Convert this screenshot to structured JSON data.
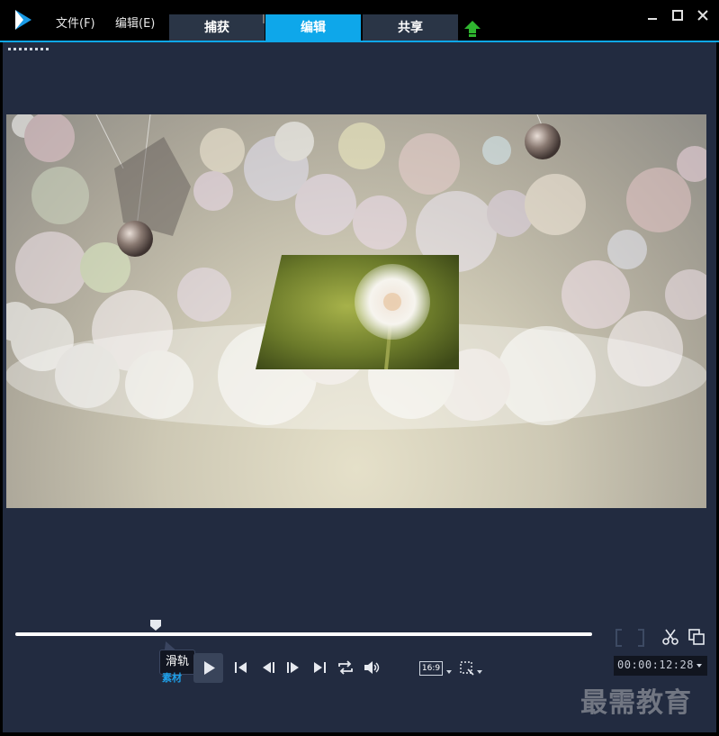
{
  "menu": {
    "file": "文件(F)",
    "edit": "编辑(E)"
  },
  "tabs": [
    {
      "label": "捕获",
      "active": false
    },
    {
      "label": "编辑",
      "active": true
    },
    {
      "label": "共享",
      "active": false
    }
  ],
  "icons": {
    "app_logo": "play-logo-icon",
    "upload": "upload-arrow-icon",
    "minimize": "minimize-icon",
    "maximize": "maximize-icon",
    "close": "close-icon",
    "scissors": "scissors-icon",
    "copy": "copy-icon",
    "crop": "crop-icon"
  },
  "colors": {
    "accent": "#0ea7ea",
    "workspace_bg": "#222b40",
    "tab_inactive": "#2a3546",
    "upload_green": "#2fb52f",
    "material_blue": "#1e9fe8"
  },
  "player": {
    "tooltip": "滑轨",
    "material_label": "素材",
    "aspect_ratio": "16:9",
    "timecode": "00:00:12:28",
    "scrubber_position": 0.24
  },
  "watermark": "最需教育"
}
